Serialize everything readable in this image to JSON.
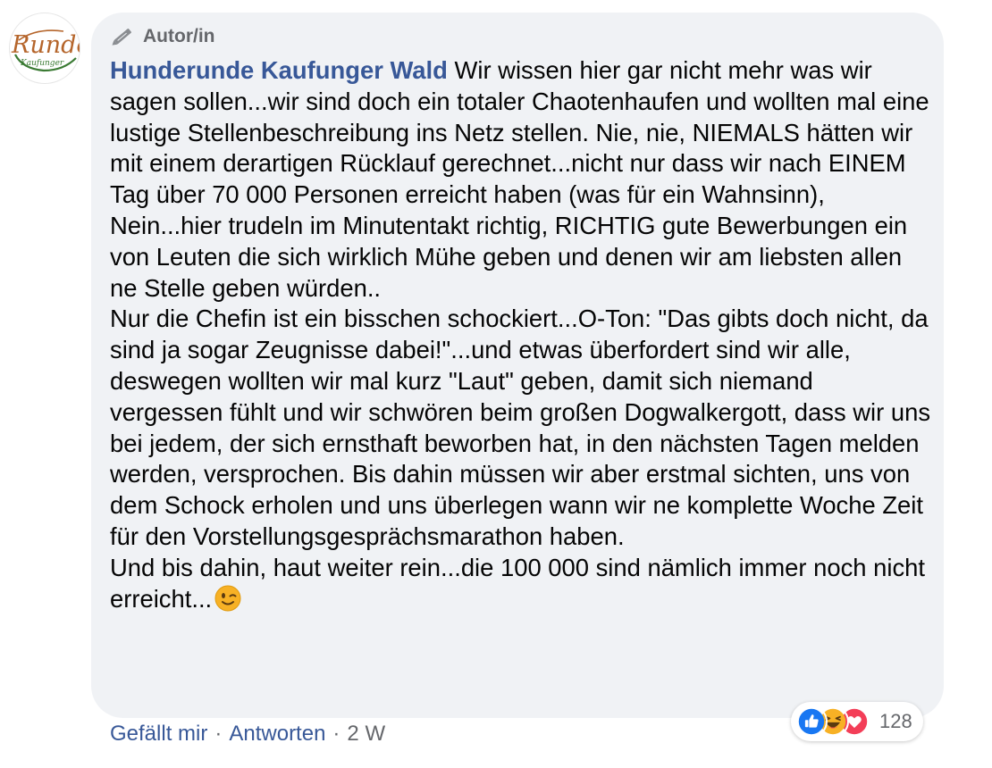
{
  "avatar": {
    "logo_text": "Runde",
    "logo_subtext": "Kaufunger",
    "icon": "hunderunde-logo"
  },
  "comment": {
    "badge_icon": "pencil-icon",
    "badge_label": "Autor/in",
    "author_name": "Hunderunde Kaufunger Wald",
    "paragraphs": [
      "Wir wissen hier gar nicht mehr was wir sagen sollen...wir sind doch ein totaler Chaotenhaufen und wollten mal eine lustige Stellenbeschreibung ins Netz stellen. Nie, nie, NIEMALS hätten wir mit einem derartigen Rücklauf gerechnet...nicht nur dass wir nach EINEM Tag über 70 000 Personen erreicht haben (was für ein Wahnsinn), Nein...hier trudeln im Minutentakt richtig, RICHTIG gute Bewerbungen ein von Leuten die sich wirklich Mühe geben und denen wir am liebsten allen ne Stelle geben würden..",
      "Nur die Chefin ist ein bisschen schockiert...O-Ton: \"Das gibts doch nicht, da sind ja sogar Zeugnisse dabei!\"...und etwas überfordert sind wir alle, deswegen wollten wir mal kurz \"Laut\" geben, damit sich niemand vergessen fühlt und wir schwören beim großen Dogwalkergott, dass wir uns bei jedem, der sich ernsthaft beworben hat, in den nächsten Tagen melden werden, versprochen. Bis dahin müssen wir aber erstmal sichten, uns von dem Schock erholen und uns überlegen wann wir ne komplette Woche Zeit für den Vorstellungsgesprächsmarathon haben.",
      "Und bis dahin, haut weiter rein...die 100 000 sind nämlich immer noch nicht erreicht..."
    ],
    "end_emoji": "wink-emoji"
  },
  "reactions": {
    "icons": [
      "like-icon",
      "haha-icon",
      "love-icon"
    ],
    "count": "128"
  },
  "actions": {
    "like_label": "Gefällt mir",
    "reply_label": "Antworten",
    "separator": "·",
    "timestamp": "2 W"
  },
  "colors": {
    "link": "#385898",
    "bubble": "#f0f2f5",
    "meta": "#65676b",
    "like_blue": "#1877f2",
    "love_red": "#f33e58",
    "haha_yellow": "#f7b125",
    "logo_green": "#3a7a33",
    "logo_brown": "#b5652b"
  }
}
